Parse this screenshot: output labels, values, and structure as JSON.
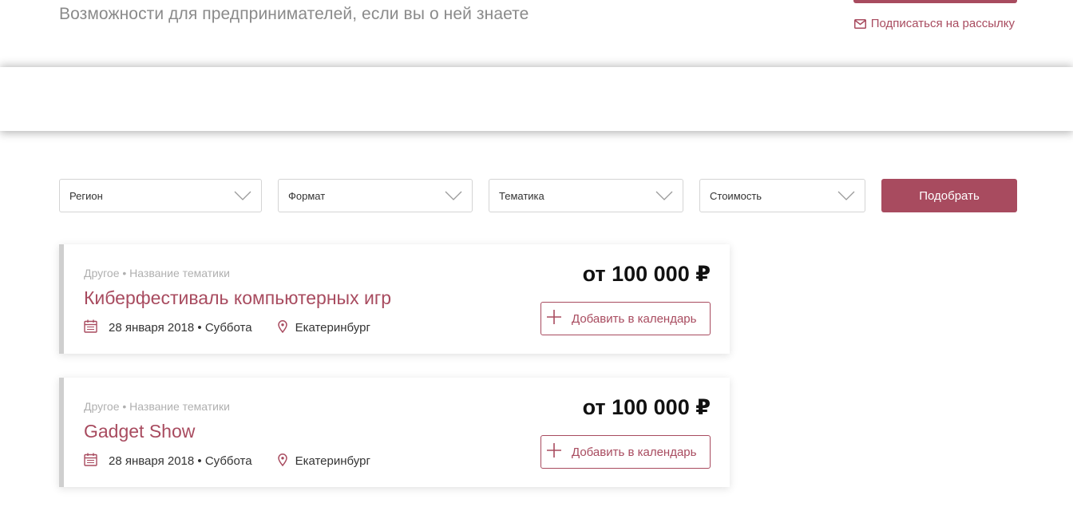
{
  "header": {
    "tagline": "Возможности для предпринимателей, если вы о ней знаете",
    "subscribe_label": "Подписаться на рассылку"
  },
  "filters": {
    "region": "Регион",
    "format": "Формат",
    "topic": "Тематика",
    "cost": "Стоимость",
    "submit_label": "Подобрать"
  },
  "events": [
    {
      "category": "Другое • Название тематики",
      "title": "Киберфестиваль компьютерных игр",
      "date": "28 января 2018 • Суббота",
      "city": "Екатеринбург",
      "price": "от 100 000 ₽",
      "add_label": "Добавить в календарь"
    },
    {
      "category": "Другое • Название тематики",
      "title": "Gadget Show",
      "date": "28 января 2018 • Суббота",
      "city": "Екатеринбург",
      "price": "от 100 000 ₽",
      "add_label": "Добавить в календарь"
    }
  ],
  "colors": {
    "accent": "#a84b5f",
    "muted_text": "#8a8a8a",
    "border": "#d4d4d4"
  }
}
